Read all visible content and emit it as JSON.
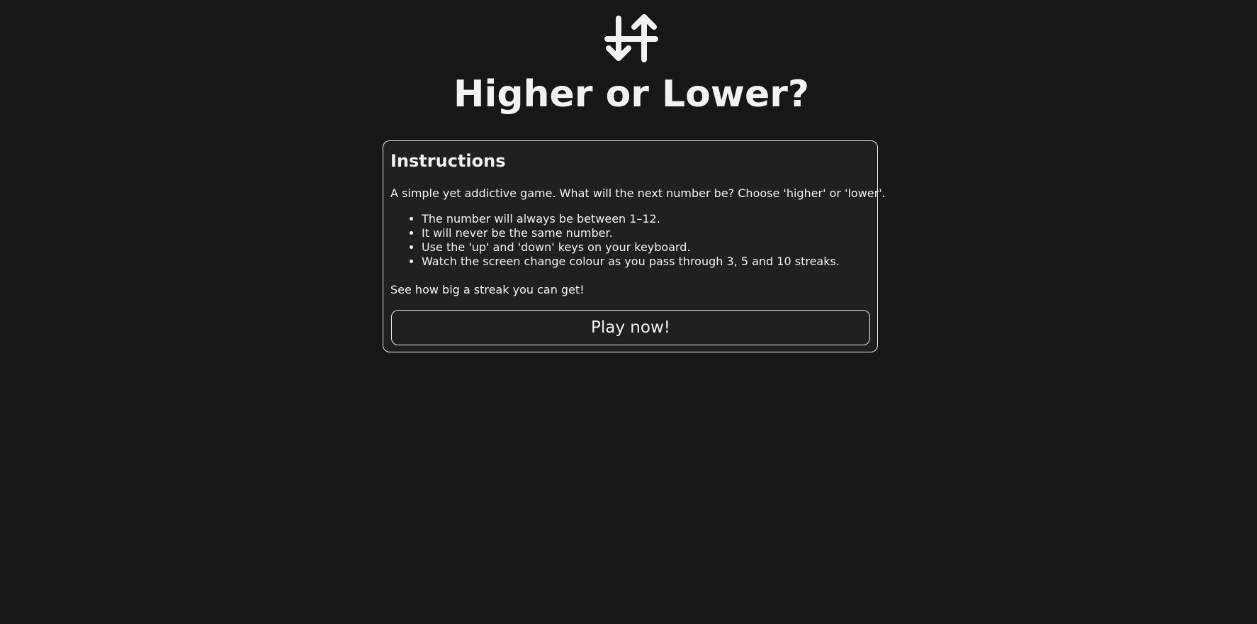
{
  "header": {
    "logo_icon": "up-down-arrows-icon",
    "title": "Higher or Lower?"
  },
  "instructions": {
    "heading": "Instructions",
    "intro": "A simple yet addictive game. What will the next number be? Choose 'higher' or 'lower'.",
    "rules": [
      "The number will always be between 1–12.",
      "It will never be the same number.",
      "Use the 'up' and 'down' keys on your keyboard.",
      "Watch the screen change colour as you pass through 3, 5 and 10 streaks."
    ],
    "outro": "See how big a streak you can get!",
    "play_label": "Play now!"
  },
  "colors": {
    "background": "#171717",
    "card": "#202020",
    "text": "#f2f2f2",
    "border": "#e6e6e6"
  }
}
